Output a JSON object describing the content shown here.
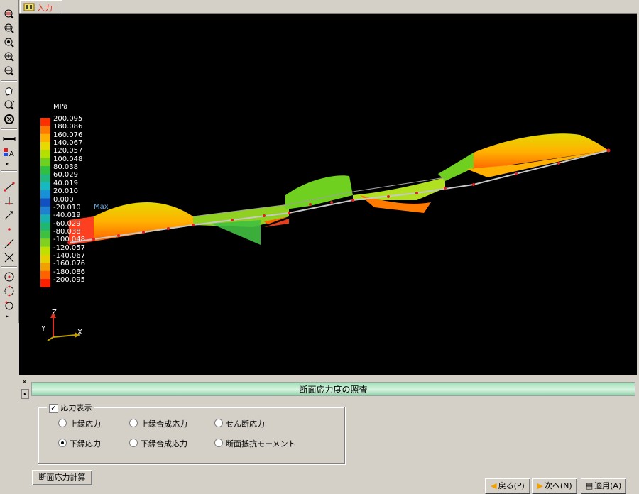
{
  "tab": {
    "label": "入力"
  },
  "viewport": {
    "unit": "MPa",
    "legend": [
      "200.095",
      "180.086",
      "160.076",
      "140.067",
      "120.057",
      "100.048",
      "80.038",
      "60.029",
      "40.019",
      "20.010",
      "0.000",
      "-20.010",
      "-40.019",
      "-60.029",
      "-80.038",
      "-100.048",
      "-120.057",
      "-140.067",
      "-160.076",
      "-180.086",
      "-200.095"
    ],
    "legend_colors": [
      "#ff3000",
      "#ff7a00",
      "#ffb000",
      "#e6d800",
      "#b4e000",
      "#70d020",
      "#30c040",
      "#20b880",
      "#18b8c0",
      "#1890d8",
      "#1050c0",
      "#2080d0",
      "#18b0b0",
      "#20b870",
      "#40c040",
      "#80d020",
      "#c0e000",
      "#e8d000",
      "#f0a000",
      "#ff6000",
      "#ff2000"
    ],
    "max_label": "Max",
    "axis": {
      "z": "Z",
      "y": "Y",
      "x": "X"
    }
  },
  "toolbar": {
    "icons": [
      "zoom-window-icon",
      "zoom-out-icon",
      "zoom-fit-icon",
      "zoom-in-icon",
      "zoom-minus-icon",
      "pan-icon",
      "zoom-realtime-icon",
      "rotate-icon",
      "measure-icon",
      "label-icon",
      "node-line-icon",
      "support-icon",
      "member-icon",
      "point-icon",
      "diagonal-icon",
      "cross-icon",
      "circle-icon",
      "ring-icon",
      "pin-icon"
    ]
  },
  "panel": {
    "title": "断面応力度の照査",
    "stress_display": {
      "label": "応力表示",
      "checked": true
    },
    "options": {
      "upper": "上縁応力",
      "upper_composite": "上縁合成応力",
      "shear": "せん断応力",
      "lower": "下縁応力",
      "lower_composite": "下縁合成応力",
      "moment": "断面抵抗モーメント"
    },
    "selected": "lower",
    "calc_button": "断面応力計算"
  },
  "footer": {
    "back": "戻る(P)",
    "next": "次へ(N)",
    "apply": "適用(A)"
  }
}
